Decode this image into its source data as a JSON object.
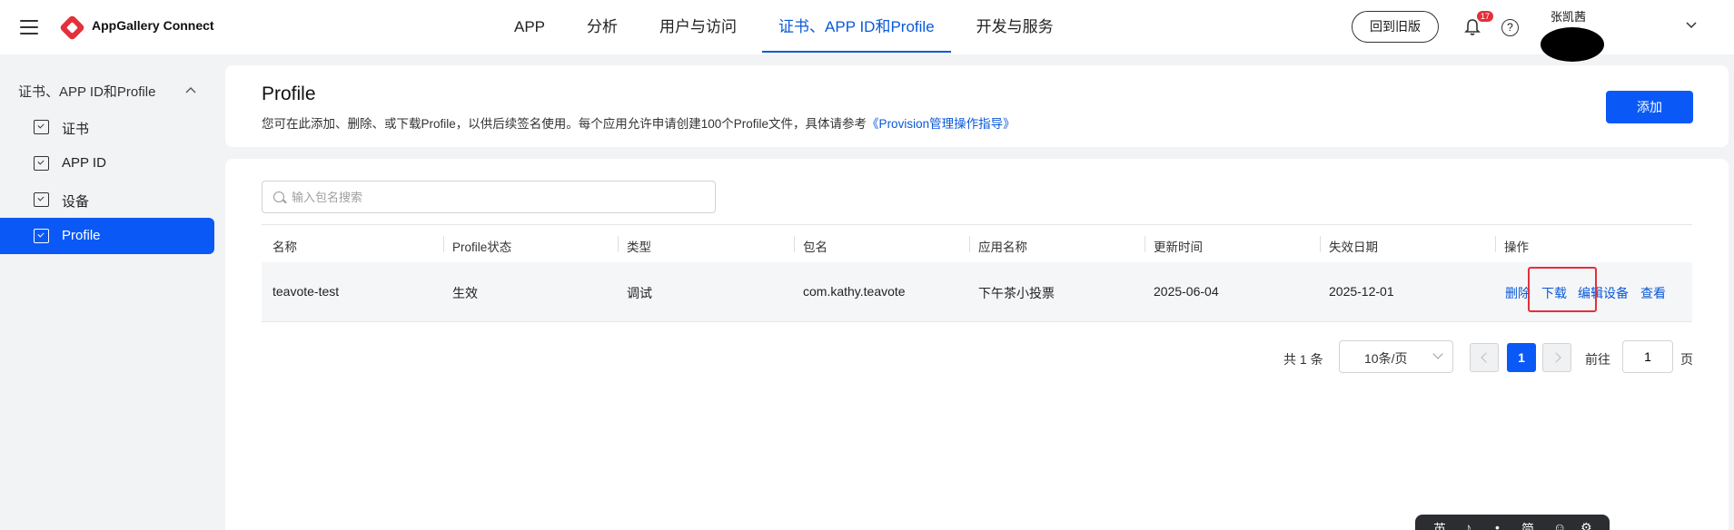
{
  "header": {
    "brand": "AppGallery Connect",
    "nav": [
      {
        "label": "APP",
        "active": false
      },
      {
        "label": "分析",
        "active": false
      },
      {
        "label": "用户与访问",
        "active": false
      },
      {
        "label": "证书、APP ID和Profile",
        "active": true
      },
      {
        "label": "开发与服务",
        "active": false
      }
    ],
    "back_label": "回到旧版",
    "notification_count": "17",
    "help_symbol": "?",
    "username": "张凯茜"
  },
  "sidebar": {
    "group_label": "证书、APP ID和Profile",
    "items": [
      {
        "label": "证书",
        "active": false
      },
      {
        "label": "APP ID",
        "active": false
      },
      {
        "label": "设备",
        "active": false
      },
      {
        "label": "Profile",
        "active": true
      }
    ]
  },
  "page": {
    "title": "Profile",
    "description": "您可在此添加、删除、或下载Profile，以供后续签名使用。每个应用允许申请创建100个Profile文件，具体请参考",
    "link_text": "《Provision管理操作指导》",
    "add_label": "添加"
  },
  "search": {
    "placeholder": "输入包名搜索"
  },
  "table": {
    "columns": [
      "名称",
      "Profile状态",
      "类型",
      "包名",
      "应用名称",
      "更新时间",
      "失效日期",
      "操作"
    ],
    "rows": [
      {
        "name": "teavote-test",
        "status": "生效",
        "type": "调试",
        "package": "com.kathy.teavote",
        "app_name": "下午茶小投票",
        "updated": "2025-06-04",
        "expires": "2025-12-01",
        "actions": [
          "删除",
          "下载",
          "编辑设备",
          "查看"
        ]
      }
    ]
  },
  "pagination": {
    "total": "共 1 条",
    "page_size": "10条/页",
    "current_page": "1",
    "goto_label": "前往",
    "goto_value": "1",
    "goto_unit": "页"
  },
  "float_toolbar": [
    "英",
    "♪",
    "•",
    "简",
    "☺",
    "⚙"
  ],
  "colors": {
    "accent": "#0a59f7",
    "link": "#0a59d8",
    "highlight": "#e4303a"
  }
}
